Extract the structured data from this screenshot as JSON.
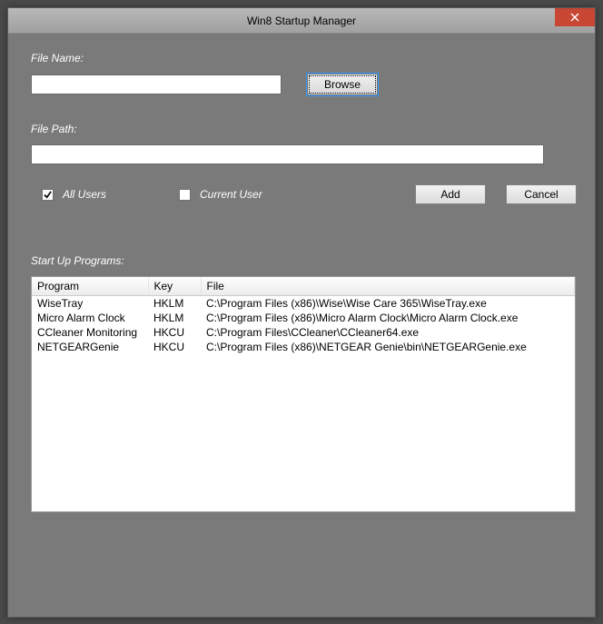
{
  "window": {
    "title": "Win8 Startup Manager"
  },
  "labels": {
    "file_name": "File Name:",
    "file_path": "File Path:",
    "startup_programs": "Start Up Programs:"
  },
  "inputs": {
    "file_name_value": "",
    "file_path_value": ""
  },
  "buttons": {
    "browse": "Browse",
    "add": "Add",
    "cancel": "Cancel"
  },
  "checkboxes": {
    "all_users": {
      "label": "All Users",
      "checked": true
    },
    "current_user": {
      "label": "Current User",
      "checked": false
    }
  },
  "table": {
    "headers": {
      "program": "Program",
      "key": "Key",
      "file": "File"
    },
    "rows": [
      {
        "program": "WiseTray",
        "key": "HKLM",
        "file": "C:\\Program Files (x86)\\Wise\\Wise Care 365\\WiseTray.exe"
      },
      {
        "program": "Micro Alarm Clock",
        "key": "HKLM",
        "file": "C:\\Program Files (x86)\\Micro Alarm Clock\\Micro Alarm Clock.exe"
      },
      {
        "program": "CCleaner Monitoring",
        "key": "HKCU",
        "file": "C:\\Program Files\\CCleaner\\CCleaner64.exe"
      },
      {
        "program": "NETGEARGenie",
        "key": "HKCU",
        "file": "C:\\Program Files (x86)\\NETGEAR Genie\\bin\\NETGEARGenie.exe"
      }
    ]
  }
}
